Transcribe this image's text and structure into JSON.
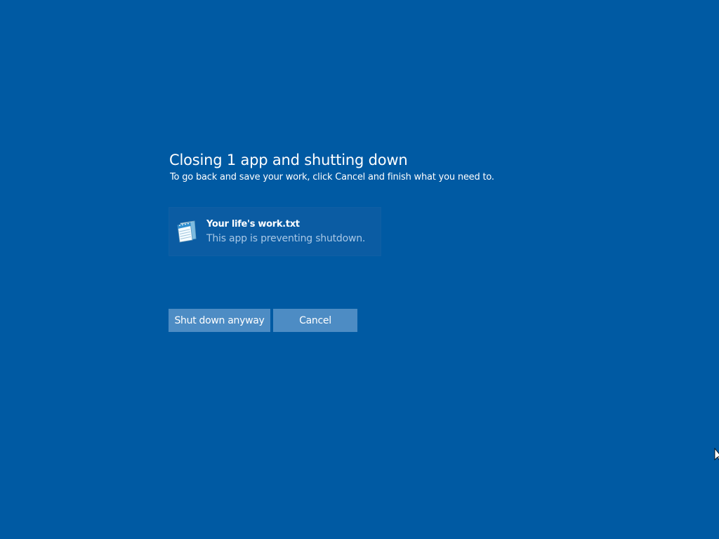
{
  "dialog": {
    "title": "Closing 1 app and shutting down",
    "subtitle": "To go back and save your work, click Cancel and finish what you need to."
  },
  "app": {
    "name": "Your life's work.txt",
    "status": "This app is preventing shutdown.",
    "icon": "notepad-icon"
  },
  "buttons": {
    "shutdown_label": "Shut down anyway",
    "cancel_label": "Cancel"
  },
  "colors": {
    "background": "#005aa3",
    "button": "#4d8cc4",
    "status_text": "#a9c8e6"
  }
}
